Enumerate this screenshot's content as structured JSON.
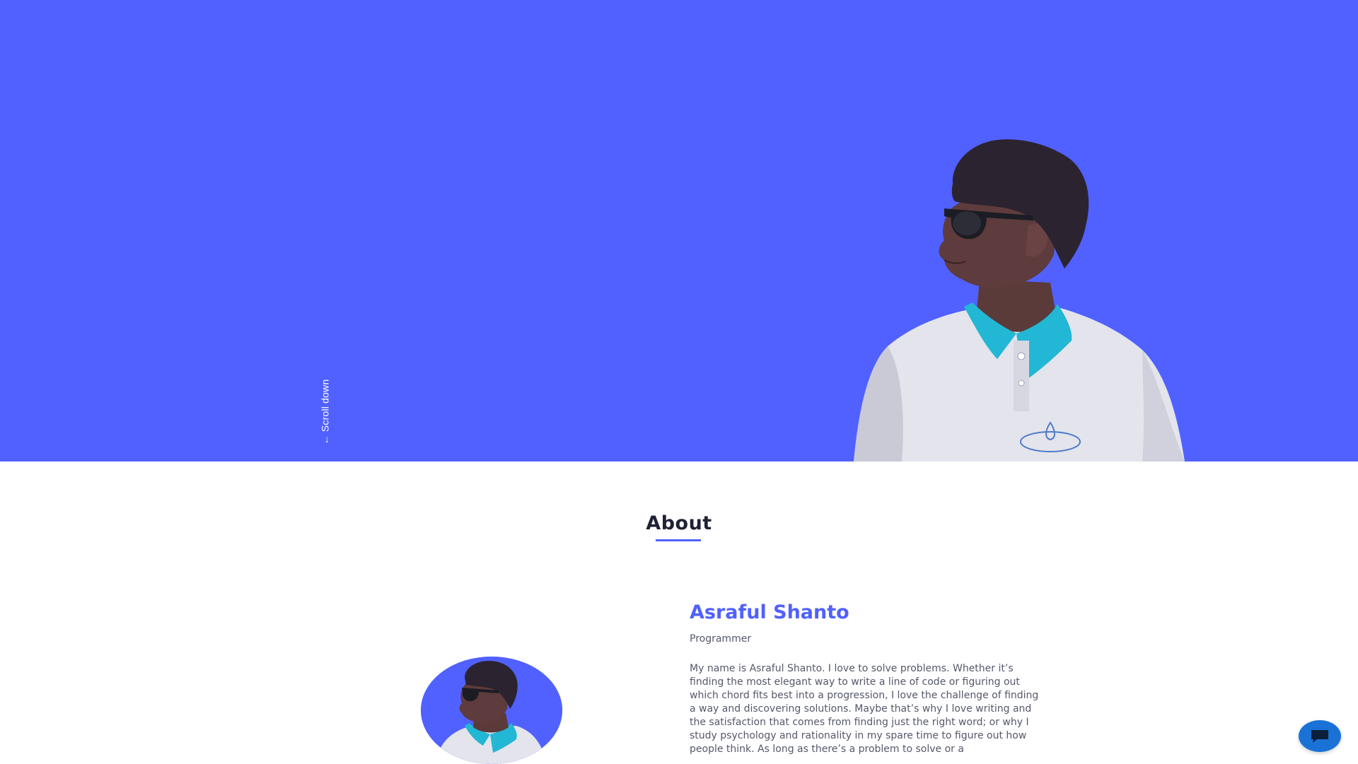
{
  "hero": {
    "background_color": "#5061ff",
    "scroll_label": "← Scroll down",
    "portrait_icon": "person-photo"
  },
  "about": {
    "heading": "About",
    "accent_color": "#5061ff",
    "avatar_icon": "person-photo",
    "name": "Asraful Shanto",
    "role": "Programmer",
    "bio": "My name is Asraful Shanto. I love to solve problems. Whether it’s finding the most elegant way to write a line of code or figuring out which chord fits best into a progression, I love the challenge of finding a way and discovering solutions. Maybe that’s why I love writing and the satisfaction that comes from finding just the right word; or why I study psychology and rationality in my spare time to figure out how people think. As long as there’s a problem to solve or a"
  },
  "chat": {
    "icon": "chat-bubble-icon",
    "color": "#1a72d6"
  }
}
